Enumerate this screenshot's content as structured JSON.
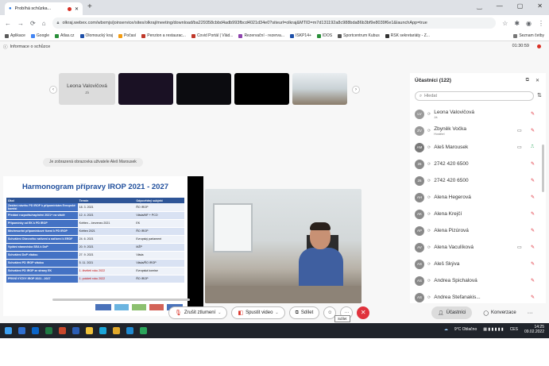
{
  "browser": {
    "tab_title": "Probíhá schůzka...",
    "new_tab": "+",
    "window_controls": [
      "‿",
      "—",
      "▢",
      "✕"
    ],
    "url": "olkraj.webex.com/wbxmjs/joinservice/sites/olkraj/meeting/download/ba229358cbbd4adb993fbcd4021d34e0?siteurl=olkraj&MTID=m7d131192a8c988bda86b3bf9e8039f6e1&launchApp=true",
    "bookmarks": [
      "Aplikace",
      "Google",
      "Atlas.cz",
      "Olomoucký kraj",
      "Počasí",
      "Penzion a restaurac...",
      "Covid Portál | Vlád...",
      "Rezervační - rezerva...",
      "ISKP14+",
      "IDOS",
      "Sportcentrum Kubus",
      "RSK sekretariáty - Z..."
    ],
    "reading_list": "Seznam četby"
  },
  "meeting": {
    "info": "Informace o schůzce",
    "timer": "01:30:59",
    "thumbnails": [
      {
        "name": "Leona Valovičová",
        "sub": "Já"
      }
    ],
    "share_banner": "Je zobrazená obrazovka uživatele Aleš Marousek",
    "slide": {
      "title": "Harmonogram přípravy IROP 2021 - 2027",
      "headers": [
        "Úkol",
        "Termín",
        "Odpovědný subjekt"
      ],
      "rows": [
        {
          "task": "Zaslání návrhu PD IROP k připomínkám Evropské komisi",
          "date": "18. 3. 2021",
          "who": "ŘO IROP",
          "red": false
        },
        {
          "task": "Předání rozpočtu/naplnění 2021+ na vládě",
          "date": "12. 4. 2021",
          "who": "Vláda/MF + PCO",
          "red": false
        },
        {
          "task": "Připomínky od EK k PD IROP",
          "date": "Květen – červenec 2021",
          "who": "EK",
          "red": false
        },
        {
          "task": "Meziresortní připomínkové řízení k PD IROP",
          "date": "Květen 2021",
          "who": "ŘO IROP",
          "red": false
        },
        {
          "task": "Schválení Obecného nařízení a nařízení k ERDF",
          "date": "24. 6. 2021",
          "who": "Evropský parlament",
          "red": false
        },
        {
          "task": "Vydání stanoviska SEA k DoP",
          "date": "20. 9. 2021",
          "who": "MŽP",
          "red": false
        },
        {
          "task": "Schválení DoP vládou",
          "date": "27. 9. 2021",
          "who": "Vláda",
          "red": false
        },
        {
          "task": "Schválení PD IROP vládou",
          "date": "5. 11. 2021",
          "who": "Vláda/ŘO IROP",
          "red": false
        },
        {
          "task": "Schválení PD IROP ze strany EK",
          "date": "1. čtvrtletí roku 2022",
          "who": "Evropská komise",
          "red": true
        },
        {
          "task": "PRVNÍ VÝZVY IROP 2021 - 2027",
          "date": "1. pololetí roku 2022",
          "who": "ŘO IROP",
          "red": true
        }
      ]
    },
    "controls": {
      "mute": "Zrušit ztlumení",
      "video": "Spustit video",
      "share": "Sdílet",
      "more": "···",
      "end": "✕",
      "tooltip": "Sdílet"
    },
    "right_controls": {
      "participants": "Účastníci",
      "conversation": "Konverzace"
    }
  },
  "participants": {
    "title": "Účastníci (122)",
    "search_placeholder": "Hledat",
    "list": [
      {
        "initials": "LV",
        "name": "Leona Valovičová",
        "sub": "Já",
        "color": "#9a9a9a",
        "video": false,
        "mic": "muted"
      },
      {
        "initials": "ZV",
        "name": "Zbyněk Vočka",
        "sub": "Hostitel",
        "color": "#9a9a9a",
        "video": true,
        "mic": "muted"
      },
      {
        "initials": "AM",
        "name": "Aleš Marousek",
        "sub": "",
        "color": "#7a7a7a",
        "video": true,
        "mic": "on"
      },
      {
        "initials": "26",
        "name": "2742 420 6500",
        "sub": "",
        "color": "#8a8a8a",
        "video": false,
        "mic": "muted"
      },
      {
        "initials": "26",
        "name": "2742 420 6500",
        "sub": "",
        "color": "#8a8a8a",
        "video": false,
        "mic": "muted"
      },
      {
        "initials": "AH",
        "name": "Alena Hegerová",
        "sub": "",
        "color": "#8a8a8a",
        "video": false,
        "mic": "muted"
      },
      {
        "initials": "AK",
        "name": "Alena Krejčí",
        "sub": "",
        "color": "#8a8a8a",
        "video": false,
        "mic": "muted"
      },
      {
        "initials": "AP",
        "name": "Alena Pizúrová",
        "sub": "",
        "color": "#8a8a8a",
        "video": false,
        "mic": "muted"
      },
      {
        "initials": "AV",
        "name": "Alena Vaculíková",
        "sub": "",
        "color": "#8a8a8a",
        "video": true,
        "mic": "muted"
      },
      {
        "initials": "AS",
        "name": "Aleš Skýva",
        "sub": "",
        "color": "#8a8a8a",
        "video": false,
        "mic": "muted"
      },
      {
        "initials": "AS",
        "name": "Andrea Spichalová",
        "sub": "",
        "color": "#8a8a8a",
        "video": false,
        "mic": "muted"
      },
      {
        "initials": "AS",
        "name": "Andrea Stefanakis...",
        "sub": "",
        "color": "#8a8a8a",
        "video": false,
        "mic": "muted"
      }
    ]
  },
  "taskbar": {
    "weather": "9°C Oblačno",
    "lang": "CES",
    "time": "14:25",
    "date": "09.02.2022"
  }
}
